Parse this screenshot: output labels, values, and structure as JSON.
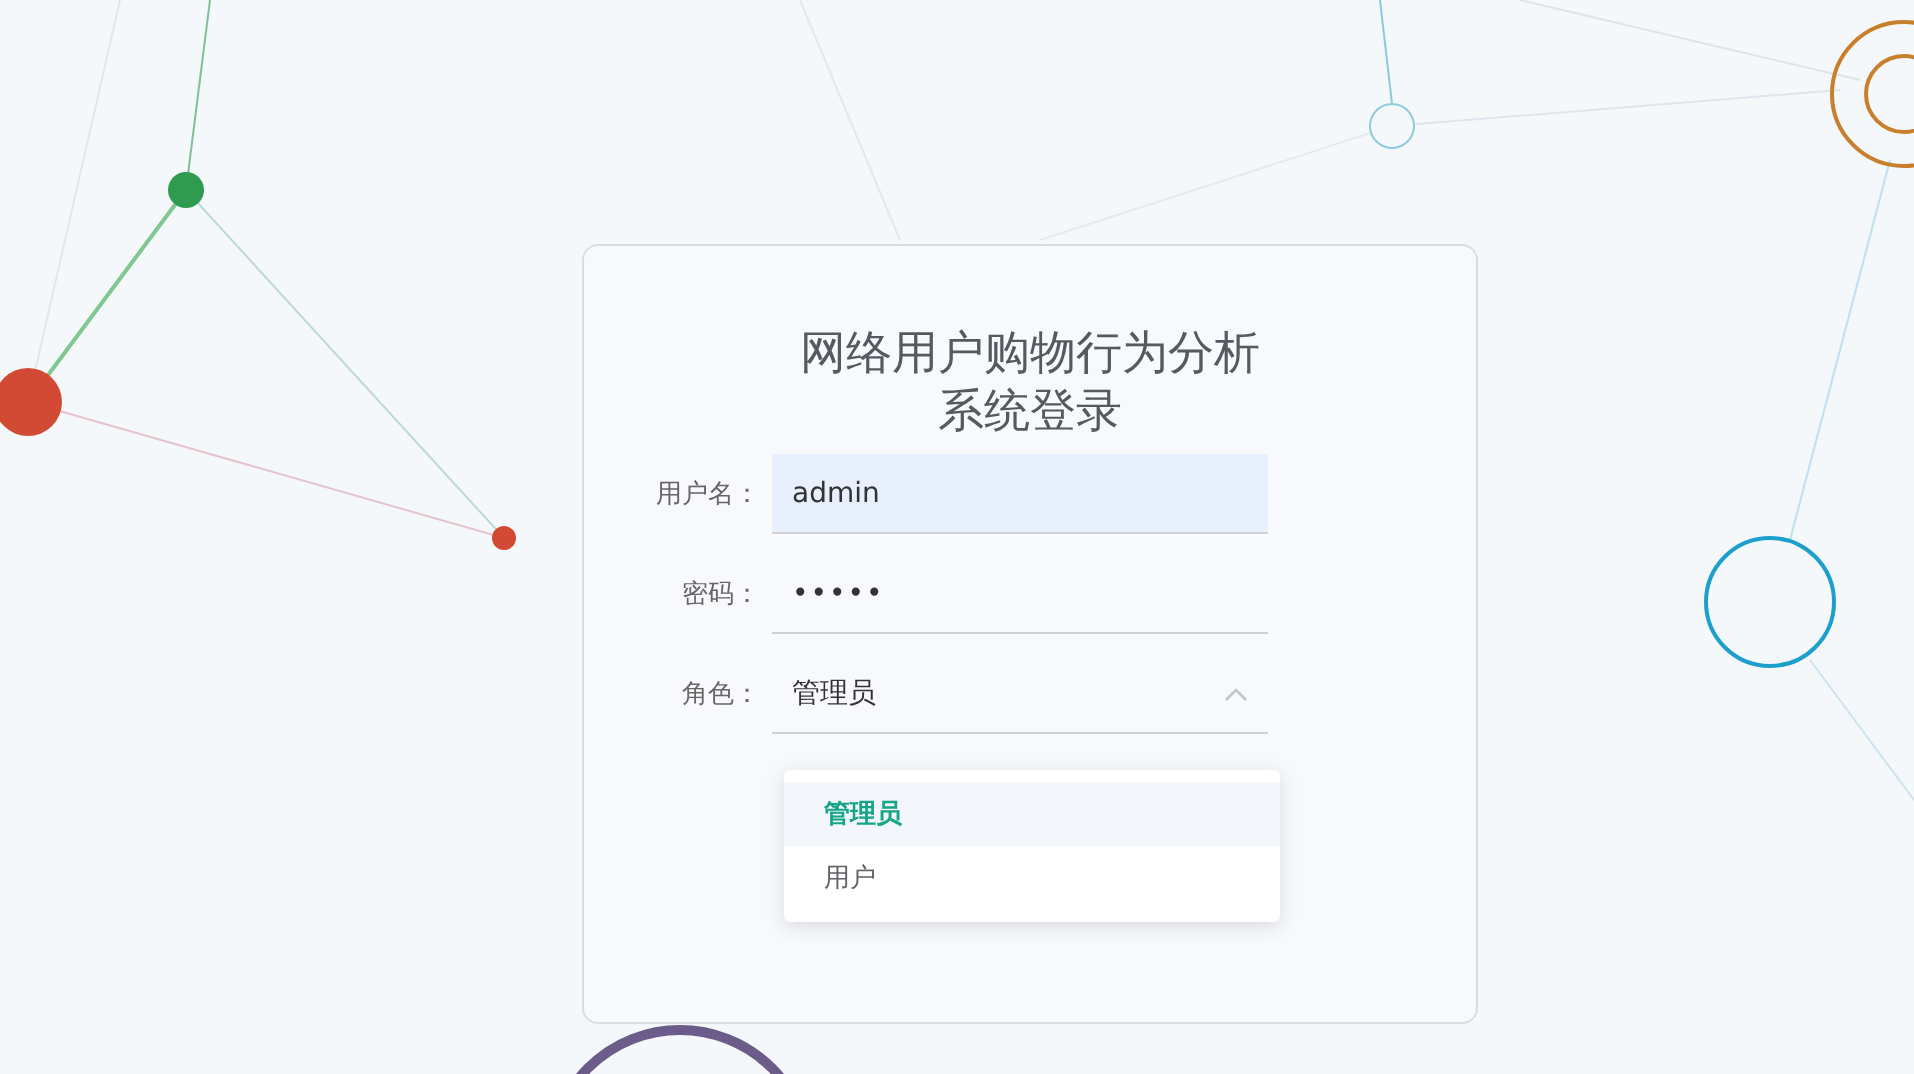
{
  "login": {
    "title": "网络用户购物行为分析系统登录",
    "fields": [
      {
        "kind": "text",
        "label": "用户名：",
        "value": "admin",
        "autofilled": true
      },
      {
        "kind": "password",
        "label": "密码：",
        "value": "•••••",
        "autofilled": false
      },
      {
        "kind": "select",
        "label": "角色：",
        "value": "管理员",
        "autofilled": false,
        "expanded": true,
        "options": [
          {
            "label": "管理员",
            "selected": true
          },
          {
            "label": "用户",
            "selected": false
          }
        ]
      }
    ]
  }
}
